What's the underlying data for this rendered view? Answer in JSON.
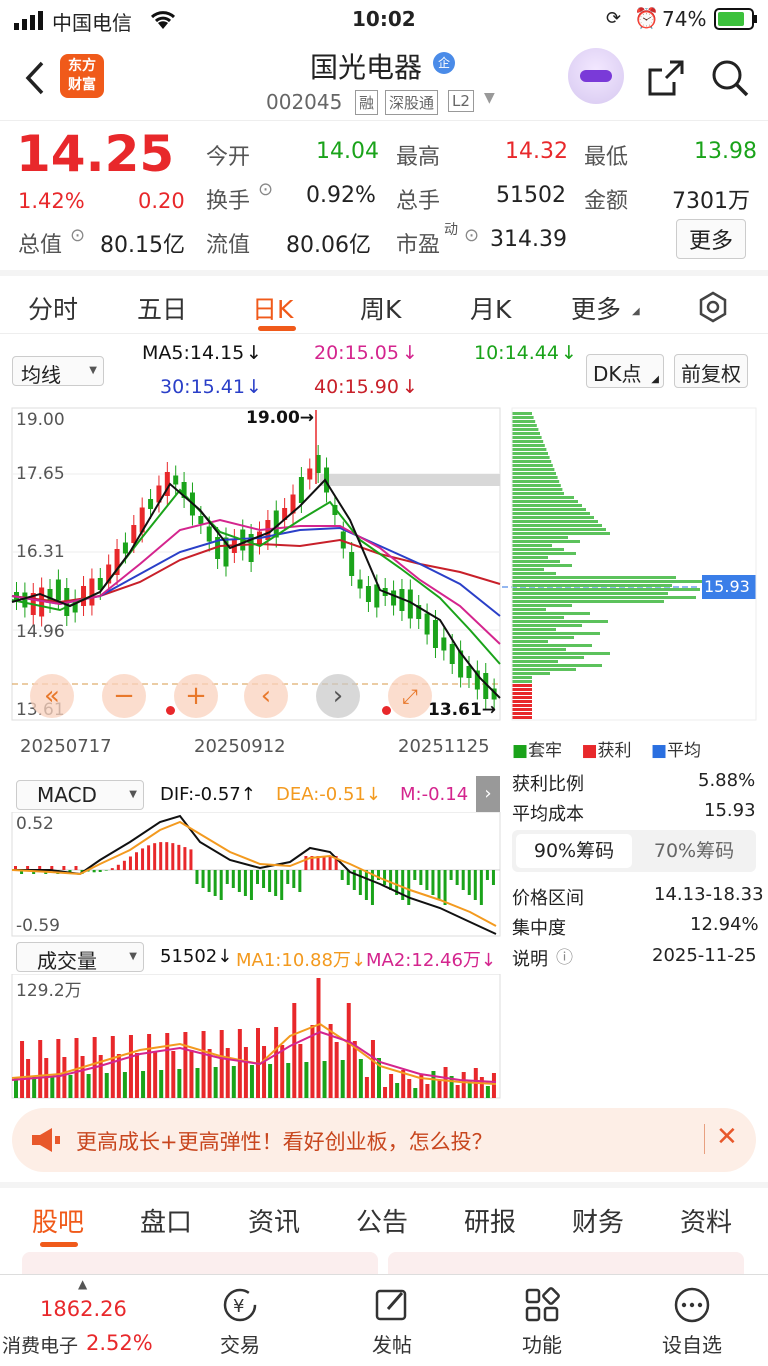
{
  "status_bar": {
    "carrier": "中国电信",
    "time": "10:02",
    "battery": "74%"
  },
  "header": {
    "title": "国光电器",
    "code": "002045",
    "tags": [
      "融",
      "深股通",
      "L2"
    ],
    "logo_line1": "东方",
    "logo_line2": "财富",
    "badge": "企"
  },
  "quote": {
    "price": "14.25",
    "change_pct": "1.42%",
    "change": "0.20",
    "rows": [
      [
        {
          "label": "今开",
          "value": "14.04",
          "color": "green"
        },
        {
          "label": "最高",
          "value": "14.32",
          "color": "red"
        },
        {
          "label": "最低",
          "value": "13.98",
          "color": "green"
        }
      ],
      [
        {
          "label": "换手",
          "value": "0.92%",
          "color": "dark"
        },
        {
          "label": "总手",
          "value": "51502",
          "color": "dark"
        },
        {
          "label": "金额",
          "value": "7301万",
          "color": "dark"
        }
      ],
      [
        {
          "label": "流值",
          "value": "80.06亿",
          "color": "dark"
        },
        {
          "label": "市盈",
          "value": "314.39",
          "color": "dark"
        }
      ]
    ],
    "total_value_label": "总值",
    "total_value": "80.15亿",
    "pe_superscript": "动",
    "more_button": "更多"
  },
  "chart_tabs": [
    "分时",
    "五日",
    "日K",
    "周K",
    "月K",
    "更多"
  ],
  "active_tab": "日K",
  "ma_panel": {
    "selector": "均线",
    "ma5": "MA5:14.15",
    "ma10": "10:14.44",
    "ma20": "20:15.05",
    "ma30": "30:15.41",
    "ma40": "40:15.90",
    "dk_button": "DK点",
    "fq_button": "前复权"
  },
  "kline": {
    "y_labels": [
      "19.00",
      "17.65",
      "16.31",
      "14.96",
      "13.61"
    ],
    "high_marker": "19.00",
    "low_marker": "13.61",
    "dates": [
      "20250717",
      "20250912",
      "20251125"
    ]
  },
  "chip": {
    "price_tag": "15.93",
    "legend": [
      "套牢",
      "获利",
      "平均"
    ],
    "rows": [
      {
        "label": "获利比例",
        "value": "5.88%"
      },
      {
        "label": "平均成本",
        "value": "15.93"
      }
    ],
    "tabs": [
      "90%筹码",
      "70%筹码"
    ],
    "rows2": [
      {
        "label": "价格区间",
        "value": "14.13-18.33"
      },
      {
        "label": "集中度",
        "value": "12.94%"
      },
      {
        "label": "说明",
        "value": "2025-11-25"
      }
    ]
  },
  "macd": {
    "selector": "MACD",
    "dif": "DIF:-0.57",
    "dea": "DEA:-0.51",
    "m": "M:-0.14",
    "top": "0.52",
    "bottom": "-0.59"
  },
  "volume": {
    "selector": "成交量",
    "value": "51502",
    "ma1": "MA1:10.88万",
    "ma2": "MA2:12.46万",
    "top": "129.2万"
  },
  "banner": {
    "text": "更高成长+更高弹性！看好创业板，怎么投？"
  },
  "bottom_tabs": [
    "股吧",
    "盘口",
    "资讯",
    "公告",
    "研报",
    "财务",
    "资料"
  ],
  "nav": {
    "index_value": "1862.26",
    "index_name": "消费电子",
    "index_pct": "2.52%",
    "items": [
      "交易",
      "发帖",
      "功能",
      "设自选"
    ]
  },
  "colors": {
    "red": "#e8282b",
    "green": "#1aa31a",
    "orange": "#f39a1f",
    "accent": "#f05a1a"
  }
}
